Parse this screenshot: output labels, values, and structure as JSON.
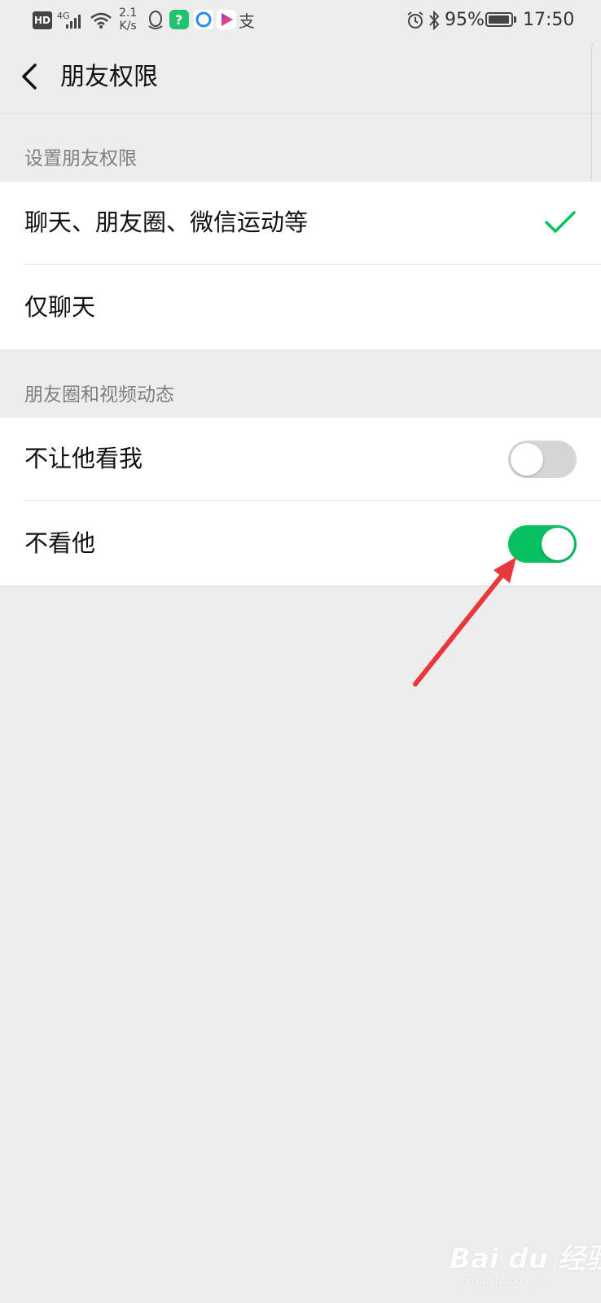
{
  "status_bar": {
    "hd": "HD",
    "network": "4G",
    "speed_value": "2.1",
    "speed_unit": "K/s",
    "battery": "95%",
    "battery_level": 0.95,
    "time": "17:50",
    "icons": [
      "signal-icon",
      "wifi-icon",
      "qq-icon",
      "app-green-icon",
      "browser-icon",
      "video-app-icon",
      "alipay-icon",
      "alarm-icon",
      "bluetooth-icon",
      "battery-icon"
    ]
  },
  "nav": {
    "title": "朋友权限",
    "back_icon": "back-chevron-icon"
  },
  "section1": {
    "header": "设置朋友权限",
    "options": [
      {
        "label": "聊天、朋友圈、微信运动等",
        "selected": true
      },
      {
        "label": "仅聊天",
        "selected": false
      }
    ]
  },
  "section2": {
    "header": "朋友圈和视频动态",
    "toggles": [
      {
        "label": "不让他看我",
        "on": false
      },
      {
        "label": "不看他",
        "on": true
      }
    ]
  },
  "colors": {
    "accent": "#07c160",
    "background": "#ededed",
    "annotation_arrow": "#e8373d"
  },
  "watermark": {
    "main": "Bai du 经验",
    "sub": "jingyan.baidu.com"
  }
}
